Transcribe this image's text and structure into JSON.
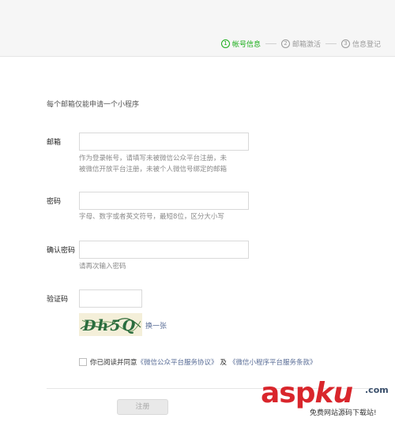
{
  "steps": [
    {
      "num": "1",
      "label": "帐号信息"
    },
    {
      "num": "2",
      "label": "邮箱激活"
    },
    {
      "num": "3",
      "label": "信息登记"
    }
  ],
  "intro": "每个邮箱仅能申请一个小程序",
  "form": {
    "email": {
      "label": "邮箱",
      "value": "",
      "hint_line1": "作为登录帐号，请填写未被微信公众平台注册，未",
      "hint_line2": "被微信开放平台注册，未被个人微信号绑定的邮箱"
    },
    "password": {
      "label": "密码",
      "value": "",
      "hint": "字母、数字或者英文符号，最短8位，区分大小写"
    },
    "confirm": {
      "label": "确认密码",
      "value": "",
      "hint": "请再次输入密码"
    },
    "captcha": {
      "label": "验证码",
      "value": "",
      "image_text": "Dh5Q",
      "swap": "换一张"
    }
  },
  "agreement": {
    "text": "你已阅读并同意",
    "link1": "《微信公众平台服务协议》",
    "and": "及",
    "link2": "《微信小程序平台服务条款》"
  },
  "register_label": "注册",
  "watermark": {
    "main": "asp",
    "ku": "ku",
    "tld": ".com",
    "sub": "免费网站源码下载站!"
  },
  "colors": {
    "accent": "#1aad19",
    "link": "#576b95",
    "watermark": "#d9262c"
  }
}
